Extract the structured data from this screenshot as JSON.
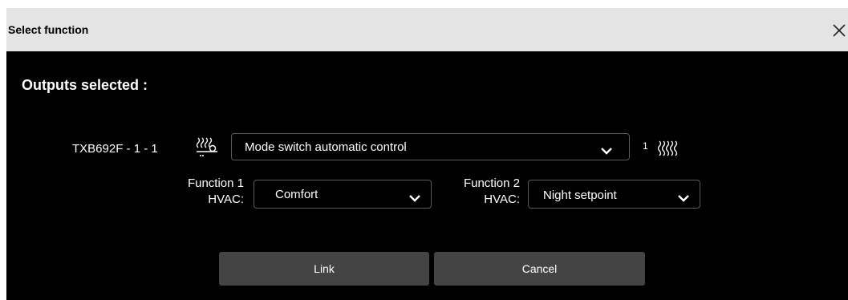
{
  "dialog": {
    "title": "Select function",
    "close_icon": "close-icon",
    "heading": "Outputs selected :"
  },
  "device": {
    "label": "TXB692F - 1 - 1",
    "icon": "heating-valve-icon",
    "mode_select": {
      "value": "Mode switch automatic control"
    },
    "count": "1",
    "count_icon": "heating-icon"
  },
  "functions": [
    {
      "label_line1": "Function 1",
      "label_line2": "HVAC:",
      "value": "Comfort"
    },
    {
      "label_line1": "Function 2",
      "label_line2": "HVAC:",
      "value": "Night setpoint"
    }
  ],
  "buttons": {
    "link": "Link",
    "cancel": "Cancel"
  },
  "colors": {
    "titlebar": "#e4e4e4",
    "background": "#000000",
    "button": "#444444",
    "text": "#ffffff"
  }
}
